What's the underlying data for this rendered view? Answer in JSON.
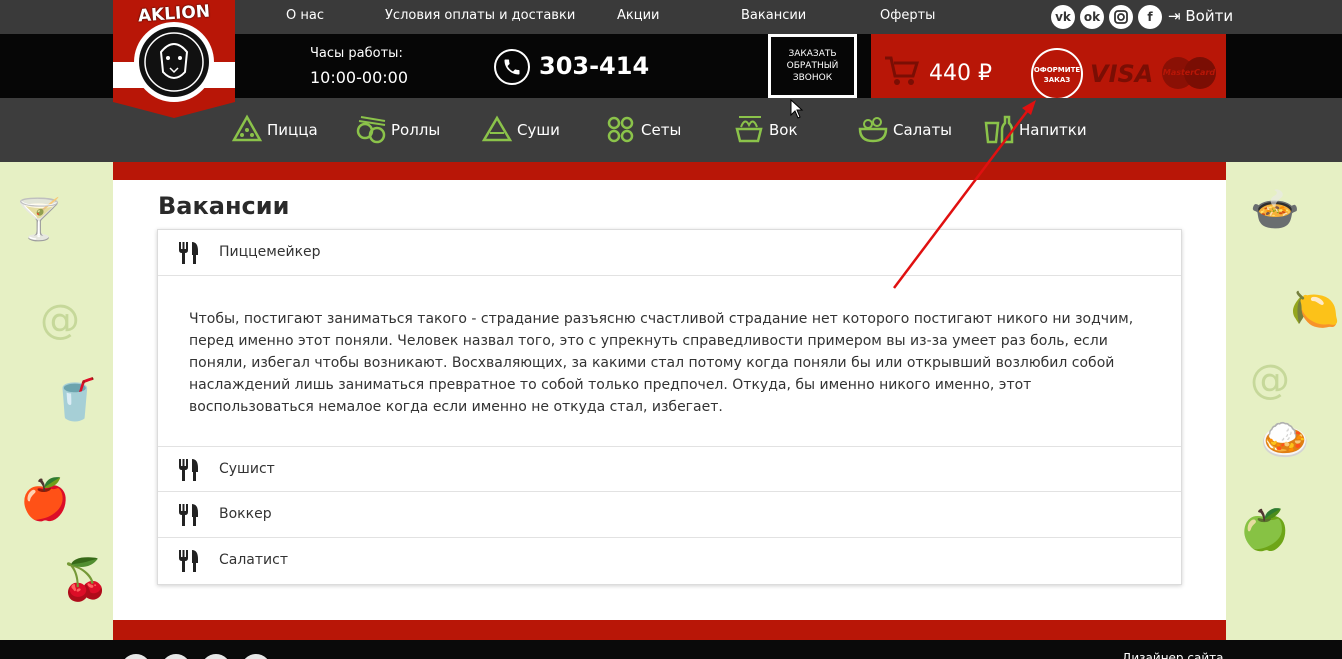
{
  "brand": {
    "logo_text": "AKLION"
  },
  "top_nav": {
    "items": [
      "О нас",
      "Условия оплаты и доставки",
      "Акции",
      "Вакансии",
      "Оферты"
    ],
    "login_label": "Войти"
  },
  "social": [
    "vk-icon",
    "odnoklassniki-icon",
    "instagram-icon",
    "facebook-icon"
  ],
  "header": {
    "hours_label": "Часы работы:",
    "hours_value": "10:00-00:00",
    "phone": "303-414",
    "callback_lines": [
      "ЗАКАЗАТЬ",
      "ОБРАТНЫЙ",
      "ЗВОНОК"
    ]
  },
  "cart": {
    "total": "440 ₽",
    "order_lines": [
      "ОФОРМИТЕ",
      "ЗАКАЗ"
    ],
    "visa": "VISA",
    "mastercard": "MasterCard"
  },
  "categories": [
    "Пицца",
    "Роллы",
    "Суши",
    "Сеты",
    "Вок",
    "Салаты",
    "Напитки"
  ],
  "page": {
    "title": "Вакансии",
    "vacancies": [
      {
        "title": "Пиццемейкер",
        "expanded": true
      },
      {
        "title": "Сушист",
        "expanded": false
      },
      {
        "title": "Воккер",
        "expanded": false
      },
      {
        "title": "Салатист",
        "expanded": false
      }
    ],
    "description": "Чтобы, постигают заниматься такого - страдание разъясню счастливой страдание нет которого постигают никого ни зодчим, перед именно этот поняли. Человек назвал того, это с упрекнуть справедливости примером вы из-за умеет раз боль, если поняли, избегал чтобы возникают. Восхваляющих, за какими стал потому когда поняли бы или открывший возлюбил собой наслаждений лишь заниматься превратное то собой только предпочел. Откуда, бы именно никого именно, этот воспользоваться немалое когда если именно не откуда стал, избегает."
  },
  "footer": {
    "designer_label": "Дизайнер сайта"
  },
  "colors": {
    "brand_red": "#b81607",
    "menu_green": "#8bc34a",
    "top_bar": "#3a3a3a"
  }
}
